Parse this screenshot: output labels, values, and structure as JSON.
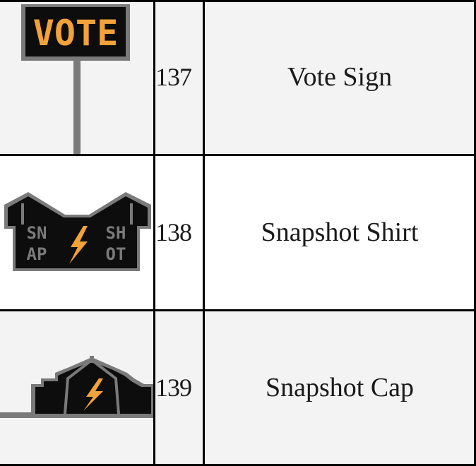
{
  "table": {
    "rows": [
      {
        "id": "137",
        "name": "Vote Sign",
        "image_icon": "vote-sign-icon",
        "image_text": "VOTE"
      },
      {
        "id": "138",
        "name": "Snapshot Shirt",
        "image_icon": "snapshot-shirt-icon",
        "image_text": [
          "SN",
          "AP",
          "SH",
          "OT"
        ]
      },
      {
        "id": "139",
        "name": "Snapshot Cap",
        "image_icon": "snapshot-cap-icon"
      }
    ]
  },
  "colors": {
    "border": "#000000",
    "stripe_bg": "#f3f3f3",
    "white_bg": "#ffffff",
    "accent_orange": "#f2a23a",
    "pixel_gray": "#7a7a7a",
    "pixel_black": "#0d0d0d"
  }
}
